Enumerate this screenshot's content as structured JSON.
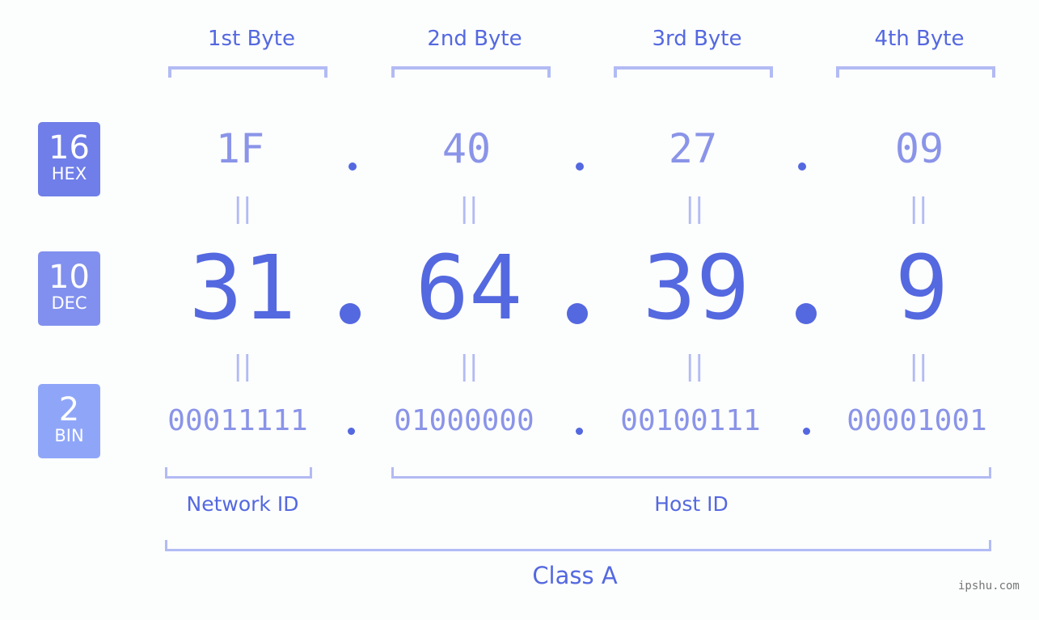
{
  "badges": [
    {
      "num": "16",
      "label": "HEX",
      "color": "#6f7ee8"
    },
    {
      "num": "10",
      "label": "DEC",
      "color": "#8190ee"
    },
    {
      "num": "2",
      "label": "BIN",
      "color": "#8fa6f8"
    }
  ],
  "bytes": [
    {
      "header": "1st Byte",
      "hex": "1F",
      "dec": "31",
      "bin": "00011111"
    },
    {
      "header": "2nd Byte",
      "hex": "40",
      "dec": "64",
      "bin": "01000000"
    },
    {
      "header": "3rd Byte",
      "hex": "27",
      "dec": "39",
      "bin": "00100111"
    },
    {
      "header": "4th Byte",
      "hex": "09",
      "dec": "9",
      "bin": "00001001"
    }
  ],
  "equals_symbol": "||",
  "labels": {
    "network_id": "Network ID",
    "host_id": "Host ID",
    "class": "Class A"
  },
  "watermark": "ipshu.com",
  "colors": {
    "primary": "#5468e0",
    "secondary": "#8a94e8",
    "bracket": "#b2bbf4"
  }
}
